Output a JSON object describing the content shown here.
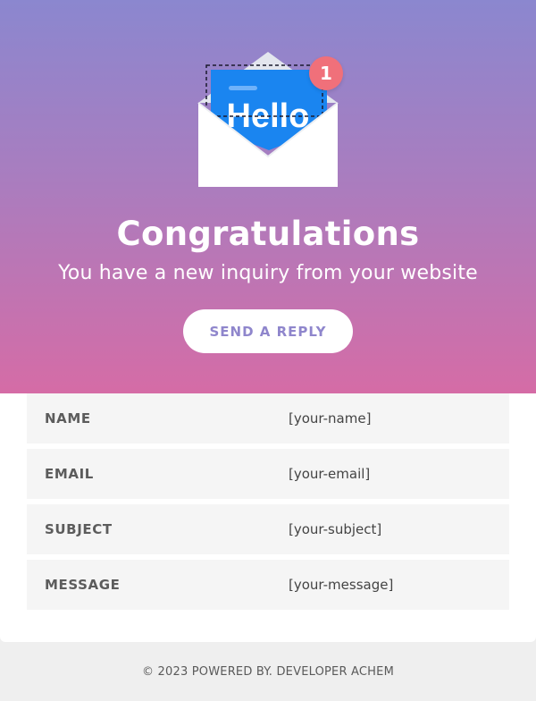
{
  "hero": {
    "illustration": {
      "icon": "envelope-icon",
      "letter_text": "Hello",
      "badge_count": "1"
    },
    "title": "Congratulations",
    "subtitle": "You have a new inquiry from your website",
    "reply_button_label": "SEND A REPLY"
  },
  "fields": [
    {
      "label": "NAME",
      "value": "[your-name]"
    },
    {
      "label": "EMAIL",
      "value": "[your-email]"
    },
    {
      "label": "SUBJECT",
      "value": "[your-subject]"
    },
    {
      "label": "MESSAGE",
      "value": "[your-message]"
    }
  ],
  "footer": {
    "text": "© 2023 POWERED BY. DEVELOPER ACHEM"
  },
  "colors": {
    "gradient_top": "#8b87cf",
    "gradient_bottom": "#d56ca6",
    "accent": "#8f86cc",
    "letter_blue": "#1a85f0",
    "badge": "#f0707a"
  }
}
